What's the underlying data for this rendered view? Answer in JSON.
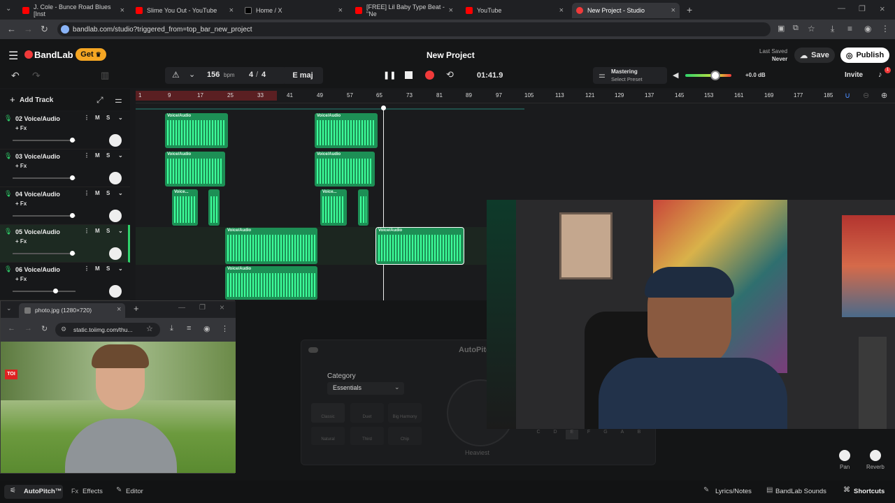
{
  "browser": {
    "tabs": [
      {
        "label": "J. Cole - Bunce Road Blues [Inst"
      },
      {
        "label": "Slime You Out - YouTube"
      },
      {
        "label": "Home / X"
      },
      {
        "label": "[FREE] Lil Baby Type Beat - \"Ne"
      },
      {
        "label": "YouTube"
      },
      {
        "label": "New Project - Studio"
      }
    ],
    "url": "bandlab.com/studio?triggered_from=top_bar_new_project"
  },
  "app": {
    "brand": "BandLab",
    "get_label": "Get",
    "project_title": "New Project",
    "last_saved_label": "Last Saved",
    "last_saved_value": "Never",
    "save_label": "Save",
    "publish_label": "Publish",
    "bpm_value": "156",
    "bpm_unit": "bpm",
    "time_sig_num": "4",
    "time_sig_den": "4",
    "key": "E maj",
    "time": "01:41.9",
    "mastering_label": "Mastering",
    "mastering_preset": "Select Preset",
    "volume_db": "+0.0 dB",
    "invite_label": "Invite",
    "notif_count": "1",
    "add_track_label": "Add Track"
  },
  "ruler": [
    "1",
    "9",
    "17",
    "25",
    "33",
    "41",
    "49",
    "57",
    "65",
    "73",
    "81",
    "89",
    "97",
    "105",
    "113",
    "121",
    "129",
    "137",
    "145",
    "153",
    "161",
    "169",
    "177",
    "185"
  ],
  "tracks": [
    {
      "name": "02 Voice/Audio",
      "fx": "+ Fx"
    },
    {
      "name": "03 Voice/Audio",
      "fx": "+ Fx"
    },
    {
      "name": "04 Voice/Audio",
      "fx": "+ Fx"
    },
    {
      "name": "05 Voice/Audio",
      "fx": "+ Fx"
    },
    {
      "name": "06 Voice/Audio",
      "fx": "+ Fx"
    }
  ],
  "mute_label": "M",
  "solo_label": "S",
  "clip_label": "Voice/Audio",
  "clip_label_short": "Voice...",
  "popup": {
    "tab_title": "photo.jpg (1280×720)",
    "url": "static.toiimg.com/thu...",
    "badge": "TOI"
  },
  "autopitch": {
    "title": "AutoPitch",
    "category_label": "Category",
    "category_value": "Essentials",
    "presets": [
      "Classic",
      "Duet",
      "Big Harmony",
      "Natural",
      "Third",
      "Chip"
    ],
    "knob_label": "Heaviest",
    "keys": [
      "C",
      "D",
      "E",
      "F",
      "G",
      "A",
      "B"
    ]
  },
  "right_knobs": {
    "pan": "Pan",
    "reverb": "Reverb"
  },
  "bottom": {
    "autopitch": "AutoPitch™",
    "effects": "Effects",
    "editor": "Editor",
    "lyrics": "Lyrics/Notes",
    "sounds": "BandLab Sounds",
    "shortcuts": "Shortcuts"
  },
  "colors": {
    "accent": "#f03a3a",
    "clip": "#1d8f55",
    "wave": "#3dff9a",
    "get": "#f5a623"
  }
}
